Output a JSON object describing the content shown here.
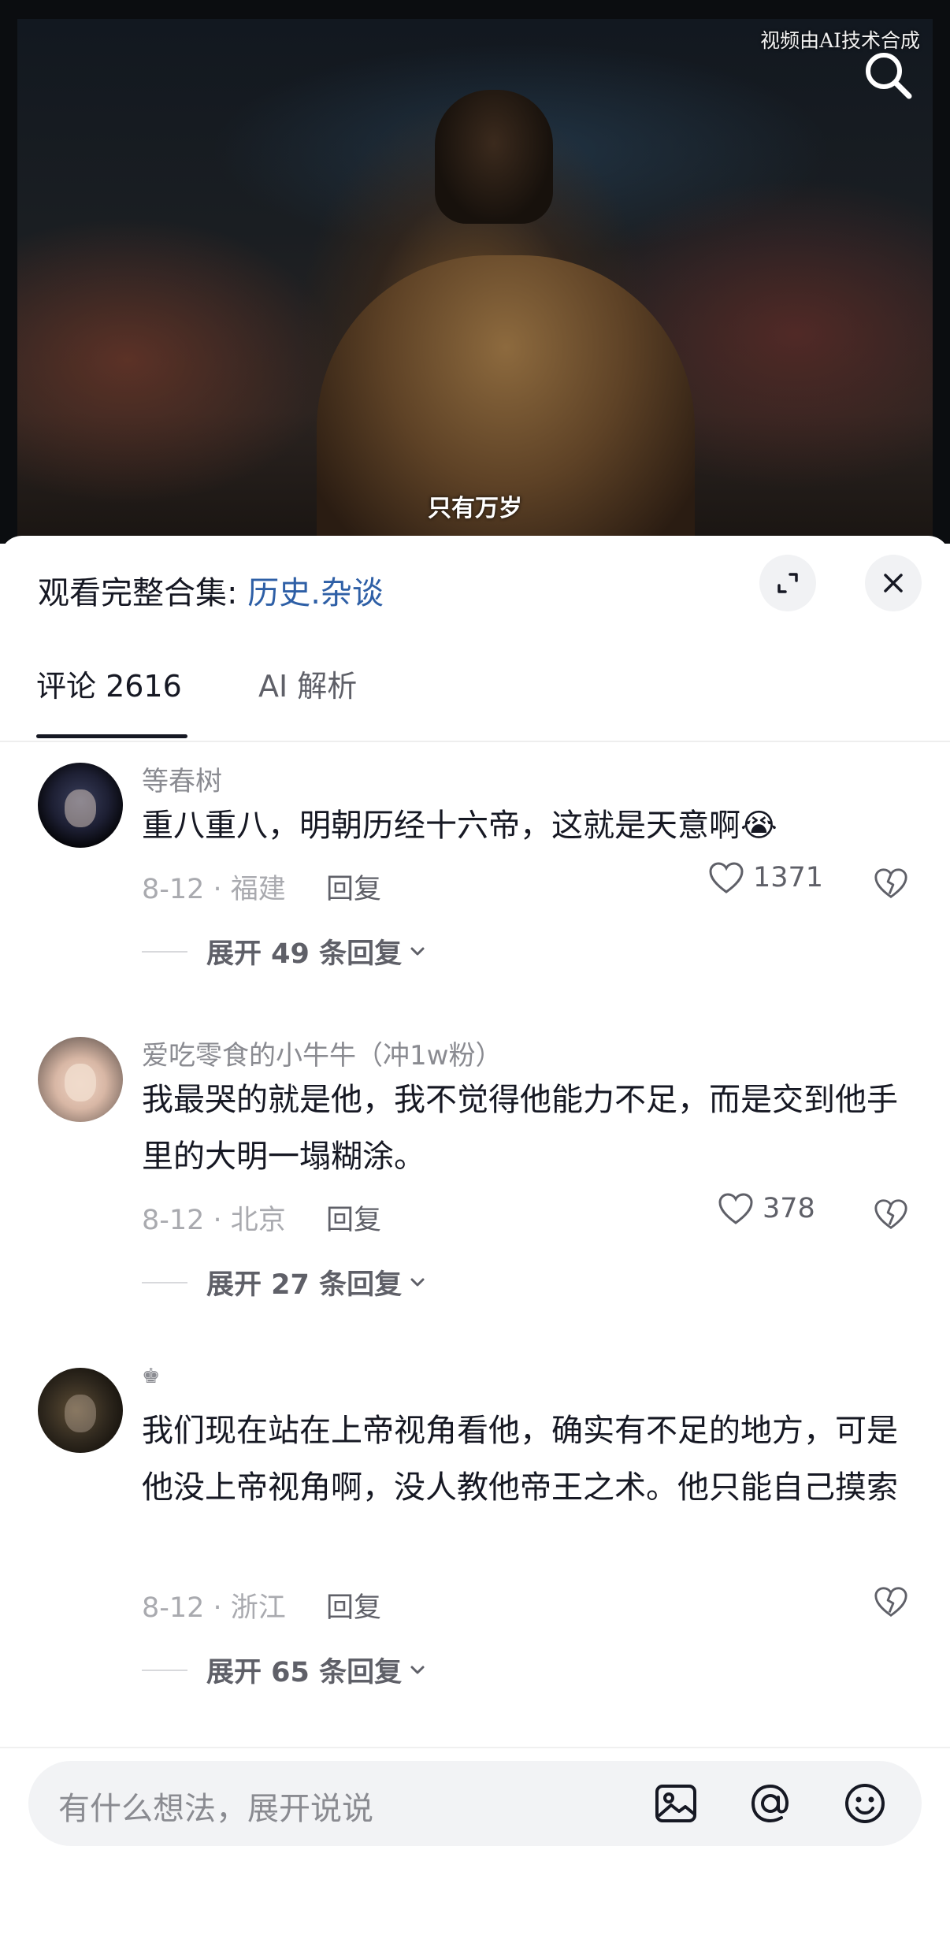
{
  "video": {
    "source_notice": "视频由AI技术合成",
    "subtitle": "只有万岁",
    "search_icon": "search-icon"
  },
  "sheet": {
    "collection_prefix": "观看完整合集: ",
    "collection_link": "历史.杂谈",
    "expand_icon": "expand-icon",
    "close_icon": "close-icon"
  },
  "tabs": [
    {
      "label": "评论 2616",
      "active": true
    },
    {
      "label": "AI 解析",
      "active": false
    }
  ],
  "comments": [
    {
      "author": "等春树",
      "text": "重八重八，明朝历经十六帝，这就是天意啊😭",
      "meta": "8-12 · 福建",
      "reply_label": "回复",
      "likes": "1371",
      "expand_label": "展开 49 条回复"
    },
    {
      "author": "爱吃零食的小牛牛（冲1w粉）",
      "text": "我最哭的就是他，我不觉得他能力不足，而是交到他手里的大明一塌糊涂。",
      "meta": "8-12 · 北京",
      "reply_label": "回复",
      "likes": "378",
      "expand_label": "展开 27 条回复"
    },
    {
      "author": "♚",
      "text": "我们现在站在上帝视角看他，确实有不足的地方，可是他没上帝视角啊，没人教他帝王之术。他只能自己摸索",
      "meta": "8-12 · 浙江",
      "reply_label": "回复",
      "likes": "",
      "expand_label": "展开 65 条回复"
    }
  ],
  "input": {
    "placeholder": "有什么想法，展开说说",
    "icons": [
      "image-icon",
      "at-icon",
      "emoji-icon"
    ]
  },
  "colors": {
    "link": "#2e5fa6",
    "text_primary": "#161823",
    "text_secondary": "#8a8b91"
  }
}
